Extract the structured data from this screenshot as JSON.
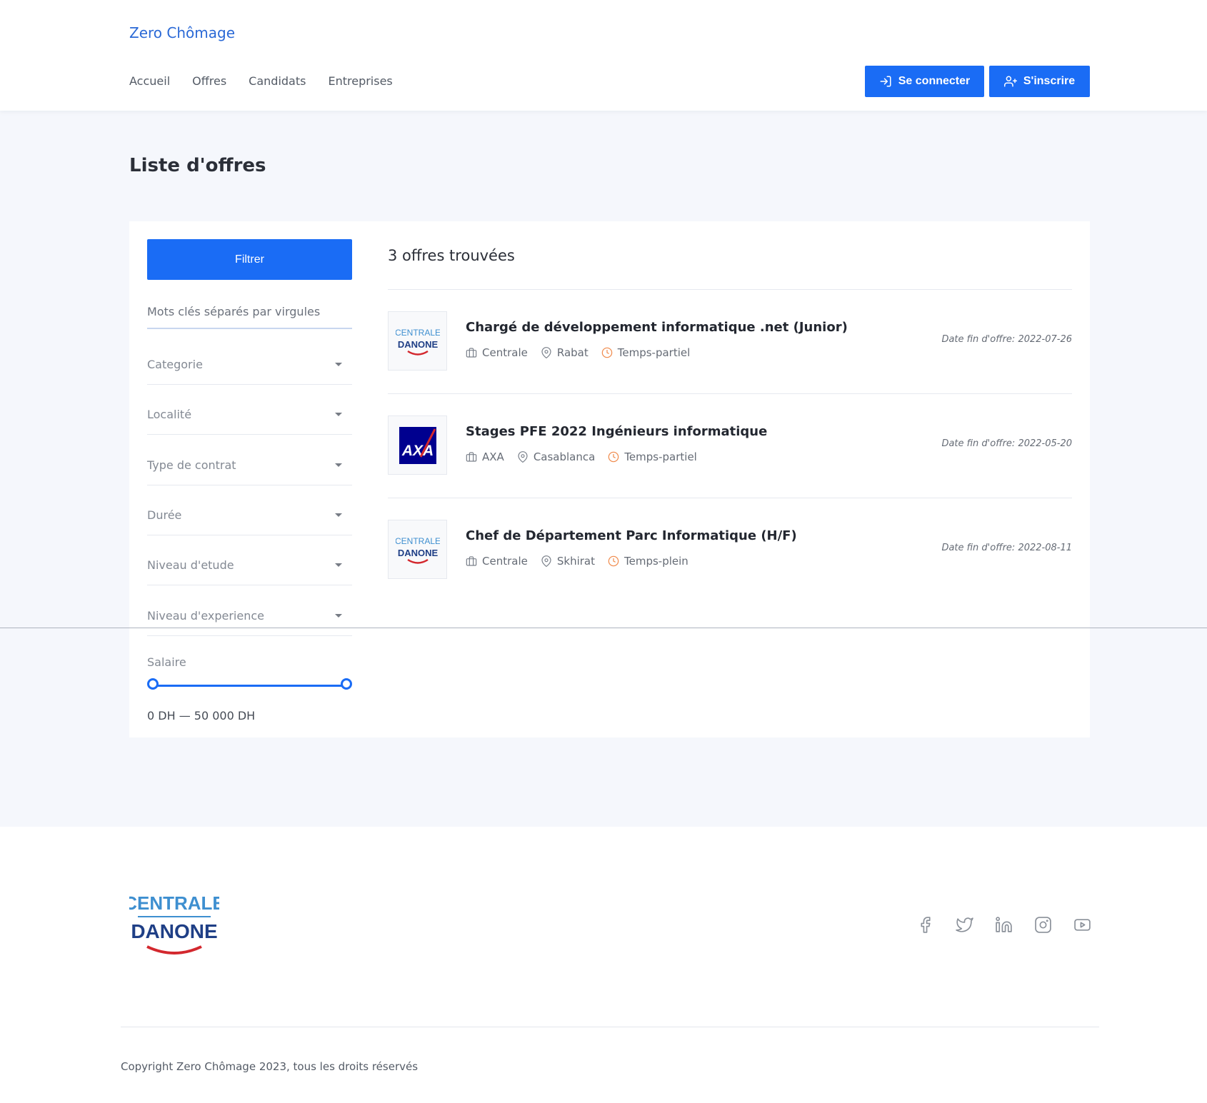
{
  "header": {
    "brand": "Zero Chômage",
    "nav": [
      "Accueil",
      "Offres",
      "Candidats",
      "Entreprises"
    ],
    "login_label": "Se connecter",
    "register_label": "S'inscrire"
  },
  "page": {
    "title": "Liste d'offres"
  },
  "filters": {
    "filter_button": "Filtrer",
    "keywords_placeholder": "Mots clés séparés par virgules",
    "selects": [
      "Categorie",
      "Localité",
      "Type de contrat",
      "Durée",
      "Niveau d'etude",
      "Niveau d'experience"
    ],
    "salary_label": "Salaire",
    "salary_min": 0,
    "salary_max": 50000,
    "salary_text": "0 DH — 50 000 DH"
  },
  "results": {
    "count_text": "3 offres trouvées",
    "jobs": [
      {
        "title": "Chargé de développement informatique .net (Junior)",
        "company": "Centrale",
        "location": "Rabat",
        "type": "Temps-partiel",
        "date": "Date fin d'offre: 2022-07-26",
        "logo": "centrale-danone-logo",
        "logo_text": [
          "CENTRALE",
          "DANONE"
        ]
      },
      {
        "title": "Stages PFE 2022 Ingénieurs informatique",
        "company": "AXA",
        "location": "Casablanca",
        "type": "Temps-partiel",
        "date": "Date fin d'offre: 2022-05-20",
        "logo": "axa-logo",
        "logo_text": [
          "AXA"
        ]
      },
      {
        "title": "Chef de Département Parc Informatique (H/F)",
        "company": "Centrale",
        "location": "Skhirat",
        "type": "Temps-plein",
        "date": "Date fin d'offre: 2022-08-11",
        "logo": "centrale-danone-logo",
        "logo_text": [
          "CENTRALE",
          "DANONE"
        ]
      }
    ]
  },
  "footer": {
    "logo_text": [
      "CENTRALE",
      "DANONE"
    ],
    "social_icons": [
      "facebook-icon",
      "twitter-icon",
      "linkedin-icon",
      "instagram-icon",
      "youtube-icon"
    ],
    "copyright": "Copyright Zero Chômage 2023, tous les droits réservés"
  },
  "colors": {
    "primary": "#1a6cf5",
    "brand_link": "#2a69d6",
    "accent_orange": "#f08a4b",
    "page_bg": "#f5f7fc",
    "danone_blue": "#1f3f86",
    "centrale_light_blue": "#3e8fd0",
    "danone_red": "#d3282e",
    "axa_blue": "#00008f"
  }
}
